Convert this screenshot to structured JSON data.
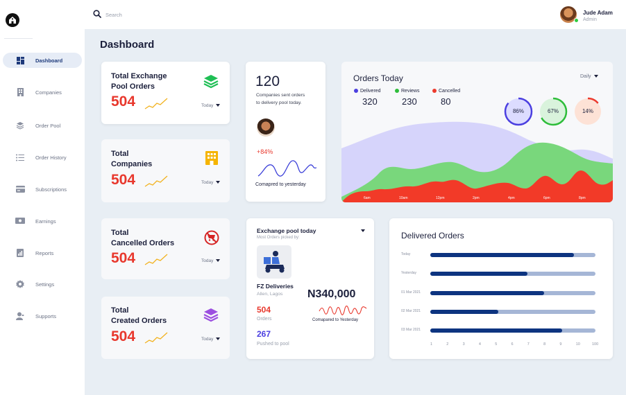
{
  "sidebar": {
    "items": [
      {
        "label": "Dashboard",
        "icon": "dashboard-icon",
        "active": true
      },
      {
        "label": "Companies",
        "icon": "building-icon"
      },
      {
        "label": "Order Pool",
        "icon": "layers-icon"
      },
      {
        "label": "Order History",
        "icon": "list-icon"
      },
      {
        "label": "Subscriptions",
        "icon": "card-icon"
      },
      {
        "label": "Earnings",
        "icon": "money-icon"
      },
      {
        "label": "Reports",
        "icon": "report-icon"
      },
      {
        "label": "Settings",
        "icon": "gear-icon"
      },
      {
        "label": "Supports",
        "icon": "support-icon"
      }
    ]
  },
  "header": {
    "search_placeholder": "Search",
    "user_name": "Jude Adam",
    "user_role": "Admin"
  },
  "page_title": "Dashboard",
  "stats": [
    {
      "title_line1": "Total Exchange",
      "title_line2": "Pool Orders",
      "value": "504",
      "period": "Today",
      "icon": "stack-green-icon"
    },
    {
      "title_line1": "Total",
      "title_line2": "Companies",
      "value": "504",
      "period": "Today",
      "icon": "building-yellow-icon"
    },
    {
      "title_line1": "Total",
      "title_line2": "Cancelled Orders",
      "value": "504",
      "period": "Today",
      "icon": "cancelled-cart-icon"
    },
    {
      "title_line1": "Total",
      "title_line2": "Created Orders",
      "value": "504",
      "period": "Today",
      "icon": "stack-purple-icon"
    }
  ],
  "companies_card": {
    "count": "120",
    "description_line1": "Companies sent orders",
    "description_line2": "to delivery pool today.",
    "change": "+84%",
    "compared": "Comapred to yesterday"
  },
  "orders_today": {
    "title": "Orders Today",
    "period": "Daily",
    "legend": [
      {
        "label": "Delivered",
        "value": "320",
        "color": "#4b3fe0"
      },
      {
        "label": "Reviews",
        "value": "230",
        "color": "#2ebd3a"
      },
      {
        "label": "Cancelled",
        "value": "80",
        "color": "#ec3a2d"
      }
    ],
    "rings": [
      {
        "label": "86%",
        "value": 0.86,
        "color": "#4b3fe0",
        "bg": "#dcdcff"
      },
      {
        "label": "67%",
        "value": 0.67,
        "color": "#2ebd3a",
        "bg": "#d9f3dc"
      },
      {
        "label": "14%",
        "value": 0.14,
        "color": "#ec3a2d",
        "bg": "#fde2d6"
      }
    ],
    "time_labels": [
      "6am",
      "10am",
      "12pm",
      "2pm",
      "4pm",
      "6pm",
      "8pm"
    ],
    "colors": {
      "purple_area": "#d6d4fb",
      "green_area": "#79d77c",
      "red_area": "#f23a28"
    }
  },
  "exchange_pool": {
    "title": "Exchange pool today",
    "subtitle": "Most Orders picked by:",
    "company": "FZ Deliveries",
    "location": "Allen, Lagos",
    "amount": "N340,000",
    "amount_compare": "Comapared to Yesterday",
    "orders_value": "504",
    "orders_label": "Orders",
    "pushed_value": "267",
    "pushed_label": "Pushed to pool"
  },
  "delivered_orders": {
    "title": "Delivered Orders",
    "rows": [
      {
        "label": "Today",
        "value": 0.87
      },
      {
        "label": "Yesterday",
        "value": 0.59
      },
      {
        "label": "01 Mar 2021",
        "value": 0.69
      },
      {
        "label": "02 Mar 2021",
        "value": 0.41
      },
      {
        "label": "03 Mar 2021",
        "value": 0.8
      }
    ],
    "axis": [
      "1",
      "2",
      "3",
      "4",
      "5",
      "6",
      "7",
      "8",
      "9",
      "10",
      "100"
    ]
  },
  "colors": {
    "accent_red": "#e8382d",
    "navy": "#0d3480",
    "green": "#2ebd3a",
    "purple": "#4b3fe0"
  }
}
